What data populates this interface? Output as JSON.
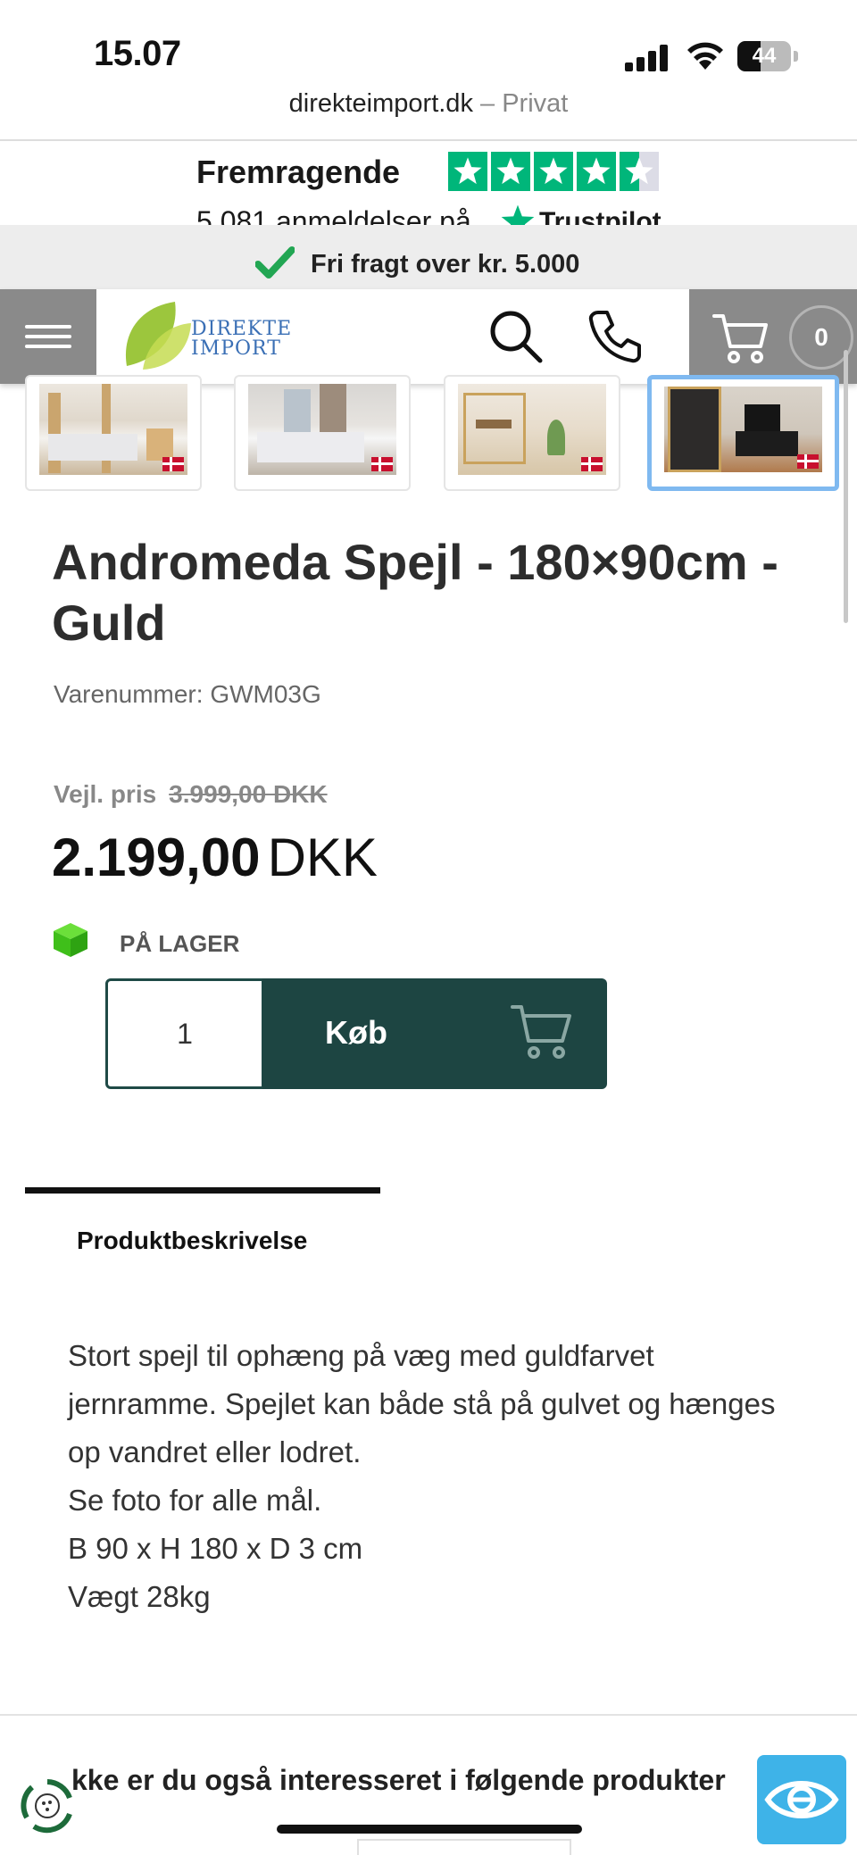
{
  "status_bar": {
    "time": "15.07",
    "battery": "44",
    "battery_level": 0.44
  },
  "browser": {
    "domain": "direkteimport.dk",
    "separator": " – ",
    "mode": "Privat"
  },
  "trustpilot": {
    "rating_label": "Fremragende",
    "review_count": "5.081",
    "review_text": "anmeldelser på",
    "brand": "Trustpilot",
    "stars": 4.5,
    "color": "#00b67a"
  },
  "shipping_banner": {
    "text": "Fri fragt over kr. 5.000",
    "check_color": "#22a653"
  },
  "nav": {
    "menu_icon": "hamburger-menu-icon",
    "logo_line1": "DIREKTE",
    "logo_line2": "IMPORT",
    "search_icon": "search-icon",
    "phone_icon": "phone-icon",
    "cart_icon": "cart-icon",
    "cart_count": "0"
  },
  "gallery": {
    "thumbnails": [
      {
        "name": "bedroom-bed-thumbnail"
      },
      {
        "name": "bedroom-room-thumbnail"
      },
      {
        "name": "dining-shelf-thumbnail"
      },
      {
        "name": "mirror-room-thumbnail",
        "active": true
      }
    ]
  },
  "product": {
    "title": "Andromeda Spejl - 180×90cm - Guld",
    "sku_label": "Varenummer:",
    "sku": "GWM03G",
    "rrp_label": "Vejl. pris",
    "rrp": "3.999,00 DKK",
    "price": "2.199,00",
    "currency": "DKK",
    "stock_status": "PÅ LAGER",
    "quantity": "1",
    "buy_label": "Køb",
    "accent_color": "#1d4542"
  },
  "tabs": {
    "description_tab": "Produktbeskrivelse"
  },
  "description": {
    "lines": [
      "Stort spejl til ophæng på væg med guldfarvet jernramme. Spejlet kan både stå på gulvet og hænges op vandret eller lodret.",
      "Se foto for alle mål.",
      "B 90 x H 180 x D 3 cm",
      "Vægt 28kg"
    ]
  },
  "related": {
    "heading": "kke er du også interesseret i følgende produkter"
  }
}
